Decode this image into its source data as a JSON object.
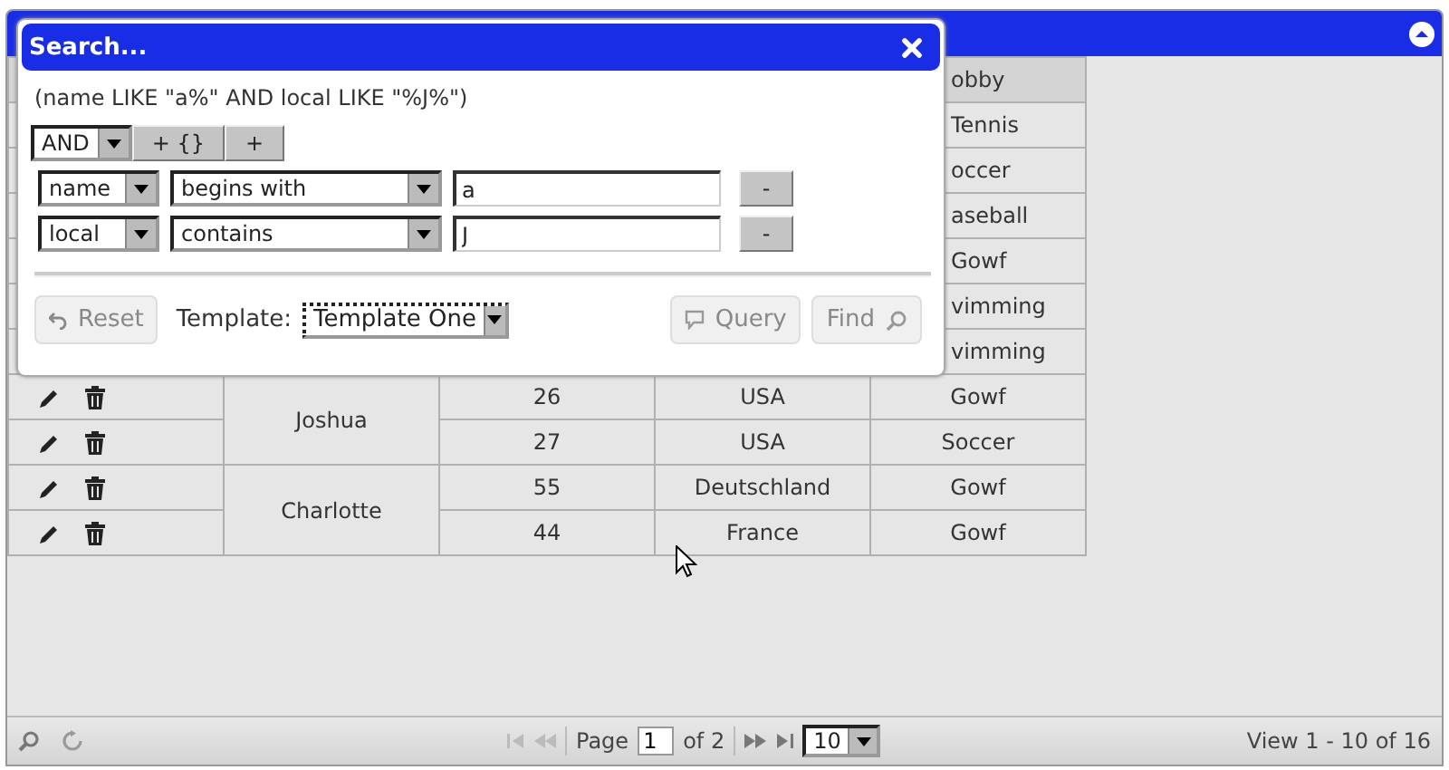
{
  "grid": {
    "hobby_header": "obby",
    "covered_hobbies": [
      "Tennis",
      "occer",
      "aseball",
      "Gowf",
      "vimming",
      "vimming"
    ],
    "groups": [
      {
        "name": "Joshua",
        "rows": [
          {
            "age": "26",
            "local": "USA",
            "hobby": "Gowf"
          },
          {
            "age": "27",
            "local": "USA",
            "hobby": "Soccer"
          }
        ]
      },
      {
        "name": "Charlotte",
        "rows": [
          {
            "age": "55",
            "local": "Deutschland",
            "hobby": "Gowf"
          },
          {
            "age": "44",
            "local": "France",
            "hobby": "Gowf"
          }
        ]
      }
    ]
  },
  "pager": {
    "page_label": "Page",
    "page": "1",
    "of": "of 2",
    "page_size": "10",
    "view": "View 1 - 10 of 16"
  },
  "dialog": {
    "title": "Search...",
    "query": "(name LIKE \"a%\" AND local LIKE \"%J%\")",
    "group_op": "AND",
    "add_group": "+ {}",
    "add_rule": "+",
    "rules": [
      {
        "field": "name",
        "op": "begins with",
        "value": "a",
        "remove": "-"
      },
      {
        "field": "local",
        "op": "contains",
        "value": "J",
        "remove": "-"
      }
    ],
    "reset": "Reset",
    "template_label": "Template:",
    "template": "Template One",
    "query_button": "Query",
    "find": "Find"
  }
}
